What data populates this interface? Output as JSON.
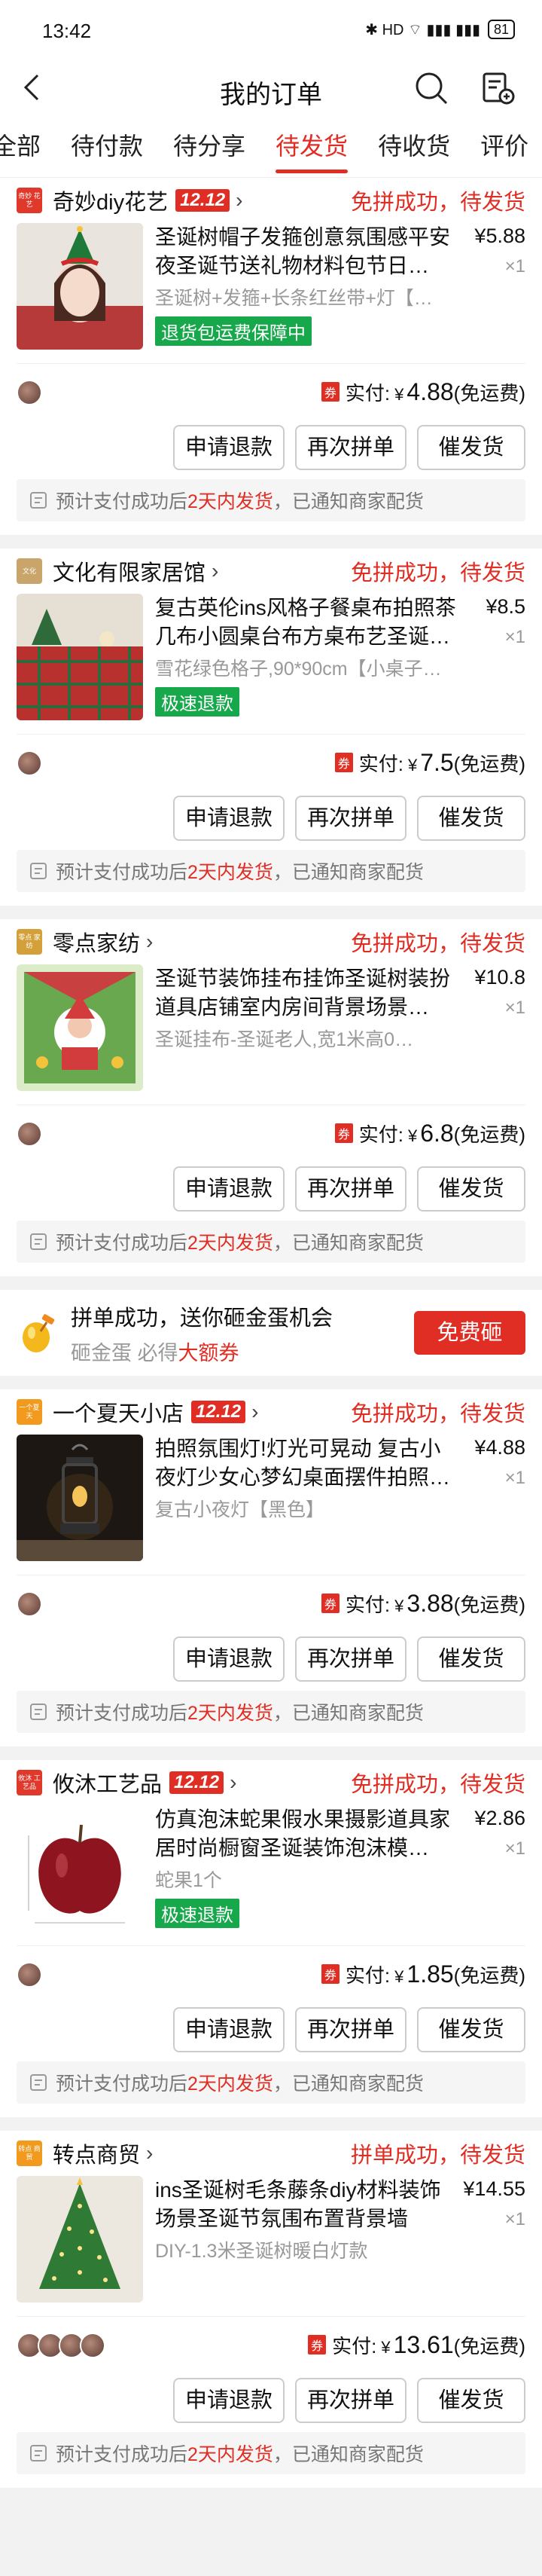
{
  "status_bar": {
    "time": "13:42",
    "icons": "✱ HD ⌔ ▮▮▮ ▮▮▮",
    "battery": "81"
  },
  "header": {
    "title": "我的订单"
  },
  "tabs": [
    "全部",
    "待付款",
    "待分享",
    "待发货",
    "待收货",
    "评价"
  ],
  "active_tab": "待发货",
  "labels": {
    "pay_prefix": "实付:",
    "currency": "¥",
    "free_shipping": "(免运费)",
    "coupon_badge": "券",
    "btn_refund": "申请退款",
    "btn_regroup": "再次拼单",
    "btn_remind": "催发货",
    "notice_pre": "预计支付成功后",
    "notice_hl": "2天内发货",
    "notice_post": "，已通知商家配货",
    "badge_1212": "12.12"
  },
  "colors": {
    "accent": "#e02e24",
    "green_tag": "#17a84c"
  },
  "promo": {
    "line1": "拼单成功，送你砸金蛋机会",
    "line2_pre": "砸金蛋 必得",
    "line2_hl": "大额券",
    "button": "免费砸"
  },
  "orders": [
    {
      "shop": "奇妙diy花艺",
      "logo_text": "奇妙 花艺",
      "logo_color": "#e0392b",
      "badge": true,
      "status": "免拼成功，待发货",
      "title": "圣诞树帽子发箍创意氛围感平安夜圣诞节送礼物材料包节日…",
      "spec": "圣诞树+发箍+长条红丝带+灯【…",
      "tag": "退货包运费保障中",
      "price": "¥5.88",
      "qty": "×1",
      "paid": "4.88",
      "avatars": 1
    },
    {
      "shop": "文化有限家居馆",
      "logo_text": "文化",
      "logo_color": "#c9a46b",
      "badge": false,
      "status": "免拼成功，待发货",
      "title": "复古英伦ins风格子餐桌布拍照茶几布小圆桌台布方桌布艺圣诞…",
      "spec": "雪花绿色格子,90*90cm【小桌子…",
      "tag": "极速退款",
      "price": "¥8.5",
      "qty": "×1",
      "paid": "7.5",
      "avatars": 1
    },
    {
      "shop": "零点家纺",
      "logo_text": "零点 家纺",
      "logo_color": "#d4a03a",
      "badge": false,
      "status": "免拼成功，待发货",
      "title": "圣诞节装饰挂布挂饰圣诞树装扮道具店铺室内房间背景场景…",
      "spec": "圣诞挂布-圣诞老人,宽1米高0…",
      "tag": "",
      "price": "¥10.8",
      "qty": "×1",
      "paid": "6.8",
      "avatars": 1
    },
    {
      "shop": "一个夏天小店",
      "logo_text": "一个夏天",
      "logo_color": "#f29a1e",
      "badge": true,
      "status": "免拼成功，待发货",
      "title": "拍照氛围灯!灯光可晃动 复古小夜灯少女心梦幻桌面摆件拍照…",
      "spec": "复古小夜灯【黑色】",
      "tag": "",
      "price": "¥4.88",
      "qty": "×1",
      "paid": "3.88",
      "avatars": 1
    },
    {
      "shop": "攸沐工艺品",
      "logo_text": "攸沐 工艺品",
      "logo_color": "#e0392b",
      "badge": true,
      "status": "免拼成功，待发货",
      "title": "仿真泡沫蛇果假水果摄影道具家居时尚橱窗圣诞装饰泡沫模…",
      "spec": "蛇果1个",
      "tag": "极速退款",
      "price": "¥2.86",
      "qty": "×1",
      "paid": "1.85",
      "avatars": 1
    },
    {
      "shop": "转点商贸",
      "logo_text": "转点 商贸",
      "logo_color": "#f29a1e",
      "badge": false,
      "status": "拼单成功，待发货",
      "title": "ins圣诞树毛条藤条diy材料装饰场景圣诞节氛围布置背景墙",
      "spec": "DIY-1.3米圣诞树暖白灯款",
      "tag": "",
      "price": "¥14.55",
      "qty": "×1",
      "paid": "13.61",
      "avatars": 4
    }
  ]
}
